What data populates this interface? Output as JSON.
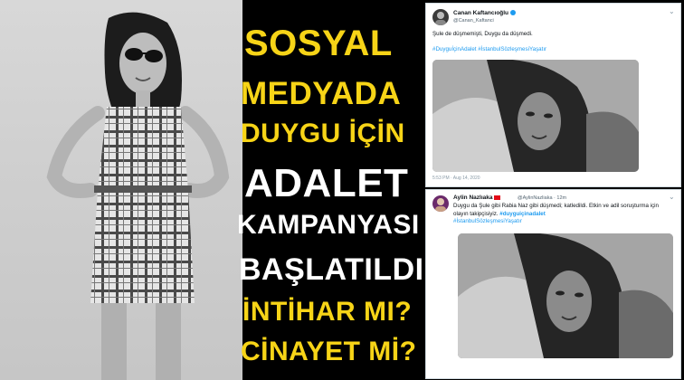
{
  "headline": {
    "line1": "SOSYAL",
    "line2": "MEDYADA",
    "line3": "DUYGU İÇİN",
    "line4": "ADALET",
    "line5": "KAMPANYASI",
    "line6": "BAŞLATILDI",
    "line7": "İNTİHAR MI?",
    "line8": "CİNAYET Mİ?",
    "yellow": "#f7d417",
    "white": "#ffffff"
  },
  "tweet1": {
    "name": "Canan Kaftancıoğlu",
    "handle": "@Canan_Kaftanci",
    "text": "Şule de düşmemişti, Duygu da düşmedi.",
    "hashtags": "#DuyguİçinAdalet #İstanbulSözleşmesiYaşatır",
    "timestamp": "5:53 PM · Aug 14, 2020",
    "more": "⌄"
  },
  "tweet2": {
    "name": "Aylin Nazlıaka",
    "handle": "@AylinNazliaka · 12m",
    "text": "Duygu da Şule gibi Rabia Naz gibi düşmedi; katledildi. Etkin ve adil soruşturma için olayın takipçisiyiz.",
    "hashtag_inline": "#duyguiçinadalet",
    "hashtags": "#İstanbulSözleşmesiYaşatır",
    "more": "⌄"
  }
}
